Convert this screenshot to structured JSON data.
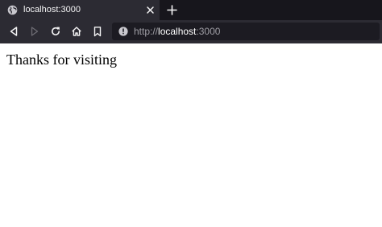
{
  "tab": {
    "title": "localhost:3000"
  },
  "address_bar": {
    "scheme": "http://",
    "host": "localhost",
    "port": ":3000"
  },
  "toolbar": {
    "icons": [
      "back-icon",
      "forward-icon",
      "reload-icon",
      "home-icon",
      "bookmark-icon"
    ]
  },
  "page": {
    "text": "Thanks for visiting"
  },
  "colors": {
    "tab_strip": "#17161c",
    "toolbar": "#2c2b33",
    "urlbar": "#1c1b22",
    "page_background": "#ffffff"
  }
}
